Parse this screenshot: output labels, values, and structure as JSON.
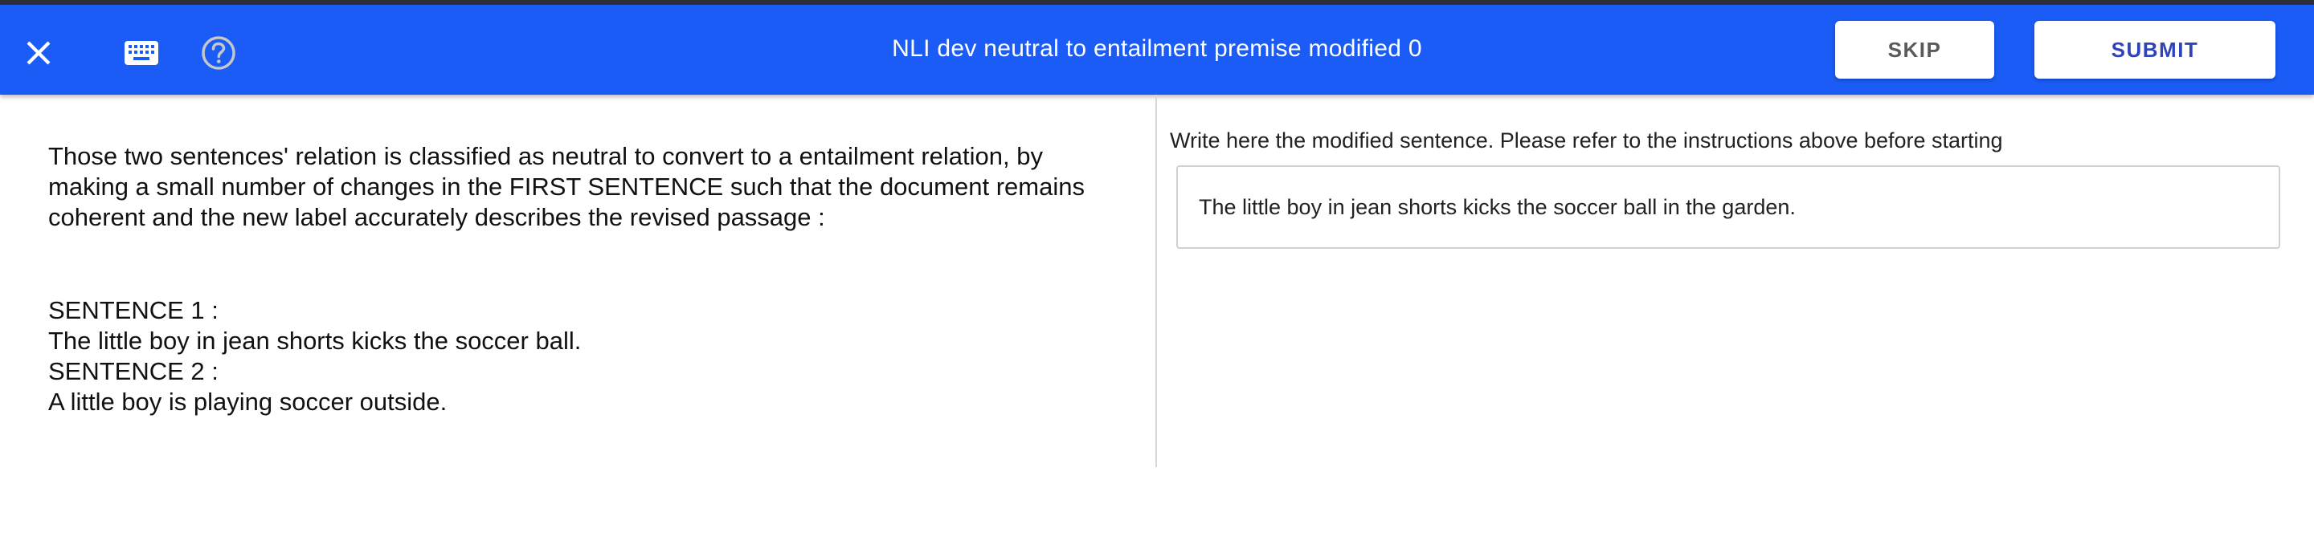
{
  "header": {
    "title": "NLI dev neutral to entailment premise modified 0",
    "skip_label": "SKIP",
    "submit_label": "SUBMIT",
    "background_color": "#1a5cf5",
    "icons": {
      "close": "close-icon",
      "keyboard": "keyboard-icon",
      "help": "help-icon"
    }
  },
  "left_panel": {
    "instructions": "Those two sentences' relation is classified as neutral to convert to a entailment relation, by making a small number of changes in the FIRST SENTENCE such that the document remains coherent and the new label accurately describes the revised passage :",
    "sentence1_label": "SENTENCE 1 :",
    "sentence1_text": "The little boy in jean shorts kicks the soccer ball.",
    "sentence2_label": "SENTENCE 2 :",
    "sentence2_text": "A little boy is playing soccer outside."
  },
  "right_panel": {
    "field_label": "Write here the modified sentence. Please refer to the instructions above before starting",
    "input_value": "The little boy in jean shorts kicks the soccer ball in the garden."
  }
}
